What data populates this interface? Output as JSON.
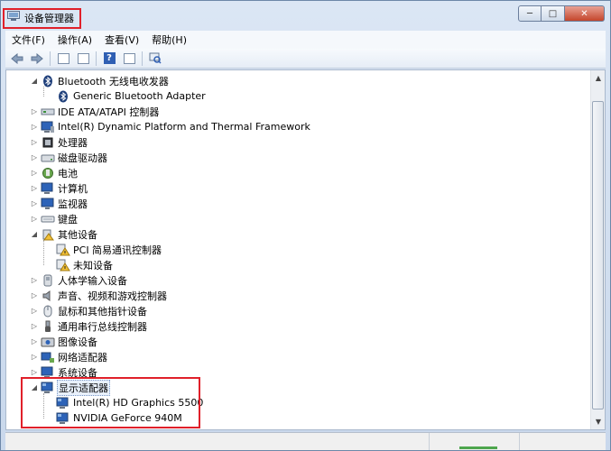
{
  "window": {
    "title": "设备管理器",
    "controls": {
      "minimize": "─",
      "maximize": "□",
      "close": "✕"
    }
  },
  "menubar": [
    {
      "label": "文件(F)"
    },
    {
      "label": "操作(A)"
    },
    {
      "label": "查看(V)"
    },
    {
      "label": "帮助(H)"
    }
  ],
  "toolbar": [
    {
      "icon": "back-arrow-icon"
    },
    {
      "icon": "forward-arrow-icon"
    },
    {
      "icon": "properties-icon"
    },
    {
      "icon": "show-hidden-icon"
    },
    {
      "icon": "help-icon"
    },
    {
      "icon": "device-view-icon"
    },
    {
      "icon": "scan-hardware-icon"
    }
  ],
  "tree": [
    {
      "label": "Bluetooth 无线电收发器",
      "level": 0,
      "state": "expanded",
      "icon": "bluetooth-icon"
    },
    {
      "label": "Generic Bluetooth Adapter",
      "level": 1,
      "state": "leaf",
      "icon": "bluetooth-icon"
    },
    {
      "label": "IDE ATA/ATAPI 控制器",
      "level": 0,
      "state": "collapsed",
      "icon": "ide-controller-icon"
    },
    {
      "label": "Intel(R) Dynamic Platform and Thermal Framework",
      "level": 0,
      "state": "collapsed",
      "icon": "monitor-device-icon"
    },
    {
      "label": "处理器",
      "level": 0,
      "state": "collapsed",
      "icon": "processor-icon"
    },
    {
      "label": "磁盘驱动器",
      "level": 0,
      "state": "collapsed",
      "icon": "disk-drive-icon"
    },
    {
      "label": "电池",
      "level": 0,
      "state": "collapsed",
      "icon": "battery-icon"
    },
    {
      "label": "计算机",
      "level": 0,
      "state": "collapsed",
      "icon": "computer-icon"
    },
    {
      "label": "监视器",
      "level": 0,
      "state": "collapsed",
      "icon": "monitor-icon"
    },
    {
      "label": "键盘",
      "level": 0,
      "state": "collapsed",
      "icon": "keyboard-icon"
    },
    {
      "label": "其他设备",
      "level": 0,
      "state": "expanded",
      "icon": "other-devices-icon"
    },
    {
      "label": "PCI 简易通讯控制器",
      "level": 1,
      "state": "leaf",
      "icon": "warning-device-icon"
    },
    {
      "label": "未知设备",
      "level": 1,
      "state": "leaf",
      "icon": "warning-device-icon"
    },
    {
      "label": "人体学输入设备",
      "level": 0,
      "state": "collapsed",
      "icon": "hid-icon"
    },
    {
      "label": "声音、视频和游戏控制器",
      "level": 0,
      "state": "collapsed",
      "icon": "speaker-icon"
    },
    {
      "label": "鼠标和其他指针设备",
      "level": 0,
      "state": "collapsed",
      "icon": "mouse-icon"
    },
    {
      "label": "通用串行总线控制器",
      "level": 0,
      "state": "collapsed",
      "icon": "usb-icon"
    },
    {
      "label": "图像设备",
      "level": 0,
      "state": "collapsed",
      "icon": "camera-icon"
    },
    {
      "label": "网络适配器",
      "level": 0,
      "state": "collapsed",
      "icon": "network-adapter-icon"
    },
    {
      "label": "系统设备",
      "level": 0,
      "state": "collapsed",
      "icon": "system-device-icon"
    },
    {
      "label": "显示适配器",
      "level": 0,
      "state": "expanded",
      "icon": "display-adapter-icon",
      "selected": true
    },
    {
      "label": "Intel(R) HD Graphics 5500",
      "level": 1,
      "state": "leaf",
      "icon": "display-adapter-icon"
    },
    {
      "label": "NVIDIA GeForce 940M",
      "level": 1,
      "state": "leaf",
      "icon": "display-adapter-icon"
    }
  ],
  "scrollbar": {
    "up": "▲",
    "down": "▼"
  },
  "colors": {
    "highlight_box": "#e0202a",
    "window_frame": "#c9d8ec",
    "selection_border": "#7a98c6"
  }
}
